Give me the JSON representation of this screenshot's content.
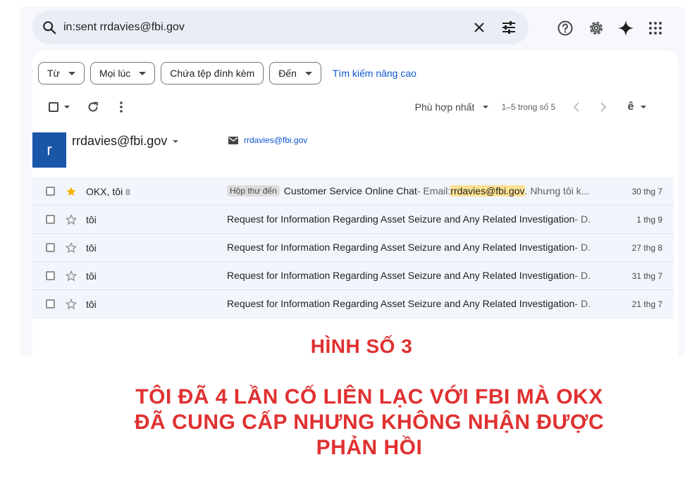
{
  "search": {
    "value": "in:sent rrdavies@fbi.gov",
    "clear_icon": "close-icon",
    "filter_icon": "tune-icon"
  },
  "top_icons": [
    "help-icon",
    "gear-icon",
    "sparkle-icon",
    "apps-grid-icon"
  ],
  "filters": {
    "chips": [
      {
        "label": "Từ",
        "has_dropdown": true
      },
      {
        "label": "Mọi lúc",
        "has_dropdown": true
      },
      {
        "label": "Chứa tệp đính kèm",
        "has_dropdown": false
      },
      {
        "label": "Đến",
        "has_dropdown": true
      }
    ],
    "advanced_link": "Tìm kiếm nâng cao"
  },
  "toolbar": {
    "sort_label": "Phù hợp nhất",
    "count_label": "1–5 trong số 5",
    "input_tools": "ê"
  },
  "contact": {
    "avatar_letter": "r",
    "name": "rrdavies@fbi.gov",
    "email": "rrdavies@fbi.gov"
  },
  "rows": [
    {
      "starred": true,
      "sender": "OKX, tôi",
      "thread_count": "8",
      "label": "Hộp thư đến",
      "subject": "Customer Service Online Chat",
      "snippet_before": " - Email: ",
      "highlight": "rrdavies@fbi.gov",
      "snippet_after": ". Nhưng tôi k...",
      "date": "30 thg 7"
    },
    {
      "starred": false,
      "sender": "tôi",
      "thread_count": "",
      "label": "",
      "subject": "Request for Information Regarding Asset Seizure and Any Related Investigation",
      "snippet_before": " - D.",
      "highlight": "",
      "snippet_after": "",
      "date": "1 thg 9"
    },
    {
      "starred": false,
      "sender": "tôi",
      "thread_count": "",
      "label": "",
      "subject": "Request for Information Regarding Asset Seizure and Any Related Investigation",
      "snippet_before": " - D.",
      "highlight": "",
      "snippet_after": "",
      "date": "27 thg 8"
    },
    {
      "starred": false,
      "sender": "tôi",
      "thread_count": "",
      "label": "",
      "subject": "Request for Information Regarding Asset Seizure and Any Related Investigation",
      "snippet_before": " - D.",
      "highlight": "",
      "snippet_after": "",
      "date": "31 thg 7"
    },
    {
      "starred": false,
      "sender": "tôi",
      "thread_count": "",
      "label": "",
      "subject": "Request for Information Regarding Asset Seizure and Any Related Investigation",
      "snippet_before": " - D.",
      "highlight": "",
      "snippet_after": "",
      "date": "21 thg 7"
    }
  ],
  "caption": {
    "title": "HÌNH SỐ 3",
    "line1": "TÔI ĐÃ 4 LẦN CỐ LIÊN LẠC VỚI FBI MÀ OKX",
    "line2": "ĐÃ CUNG CẤP NHƯNG KHÔNG NHẬN ĐƯỢC",
    "line3": "PHẢN HỒI"
  },
  "colors": {
    "accent_blue": "#0b57d0",
    "avatar_bg": "#1a56a8",
    "caption_red": "#e03131",
    "highlight": "#fde293",
    "star_gold": "#f4b400"
  }
}
